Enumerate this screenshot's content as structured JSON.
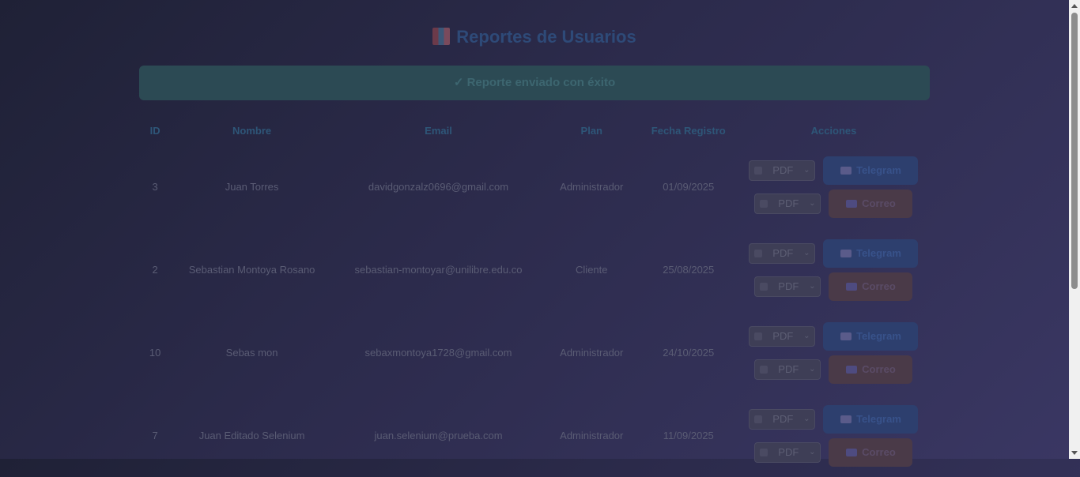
{
  "page": {
    "title": "Reportes de Usuarios",
    "title_icon": "bar-chart-icon",
    "alert": "✓ Reporte enviado con éxito"
  },
  "table": {
    "headers": [
      "ID",
      "Nombre",
      "Email",
      "Plan",
      "Fecha Registro",
      "Acciones"
    ],
    "rows": [
      {
        "id": "3",
        "name": "Juan Torres",
        "email": "davidgonzalz0696@gmail.com",
        "plan": "Administrador",
        "date": "01/09/2025"
      },
      {
        "id": "2",
        "name": "Sebastian Montoya Rosano",
        "email": "sebastian-montoyar@unilibre.edu.co",
        "plan": "Cliente",
        "date": "25/08/2025"
      },
      {
        "id": "10",
        "name": "Sebas mon",
        "email": "sebaxmontoya1728@gmail.com",
        "plan": "Administrador",
        "date": "24/10/2025"
      },
      {
        "id": "7",
        "name": "Juan Editado Selenium",
        "email": "juan.selenium@prueba.com",
        "plan": "Administrador",
        "date": "11/09/2025"
      }
    ],
    "actions": {
      "format_select": "PDF",
      "telegram_label": "Telegram",
      "mail_label": "Correo"
    }
  },
  "colors": {
    "accent": "#2e4a78",
    "telegram": "#2d3f6e",
    "mail": "#4a3a48"
  }
}
